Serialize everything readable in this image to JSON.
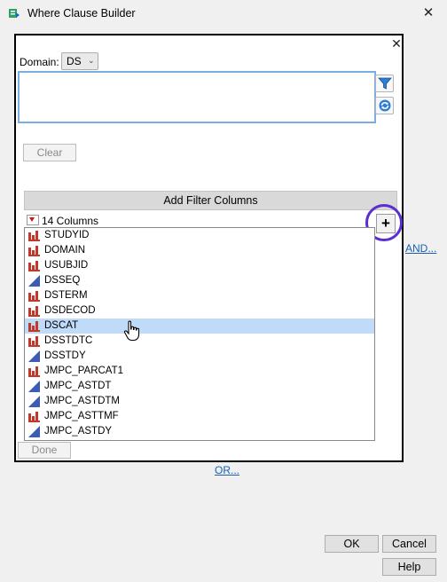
{
  "window": {
    "title": "Where Clause Builder",
    "close_glyph": "✕"
  },
  "panel": {
    "close_glyph": "✕"
  },
  "domain": {
    "label": "Domain:",
    "value": "DS"
  },
  "buttons": {
    "clear": "Clear",
    "add_filter_columns": "Add Filter Columns",
    "add_glyph": "+",
    "done": "Done",
    "ok": "OK",
    "cancel": "Cancel",
    "help": "Help"
  },
  "columns": {
    "count_label": "14 Columns",
    "items": [
      {
        "name": "STUDYID",
        "type": "nominal"
      },
      {
        "name": "DOMAIN",
        "type": "nominal"
      },
      {
        "name": "USUBJID",
        "type": "nominal"
      },
      {
        "name": "DSSEQ",
        "type": "continuous"
      },
      {
        "name": "DSTERM",
        "type": "nominal"
      },
      {
        "name": "DSDECOD",
        "type": "nominal"
      },
      {
        "name": "DSCAT",
        "type": "nominal",
        "selected": true
      },
      {
        "name": "DSSTDTC",
        "type": "nominal"
      },
      {
        "name": "DSSTDY",
        "type": "continuous"
      },
      {
        "name": "JMPC_PARCAT1",
        "type": "nominal"
      },
      {
        "name": "JMPC_ASTDT",
        "type": "continuous"
      },
      {
        "name": "JMPC_ASTDTM",
        "type": "continuous"
      },
      {
        "name": "JMPC_ASTTMF",
        "type": "nominal"
      },
      {
        "name": "JMPC_ASTDY",
        "type": "continuous"
      }
    ]
  },
  "links": {
    "and": "AND...",
    "or": "OR..."
  },
  "colors": {
    "accent_link": "#1a5fb4",
    "highlight_ring": "#5a2fd0",
    "selected_row": "#bfdbf8",
    "nominal_icon": "#c0392b",
    "continuous_icon": "#3b5bb5"
  },
  "icons": {
    "title": "where-builder-icon",
    "filter": "funnel-icon",
    "refresh": "refresh-icon",
    "cursor": "hand-pointer-icon"
  }
}
